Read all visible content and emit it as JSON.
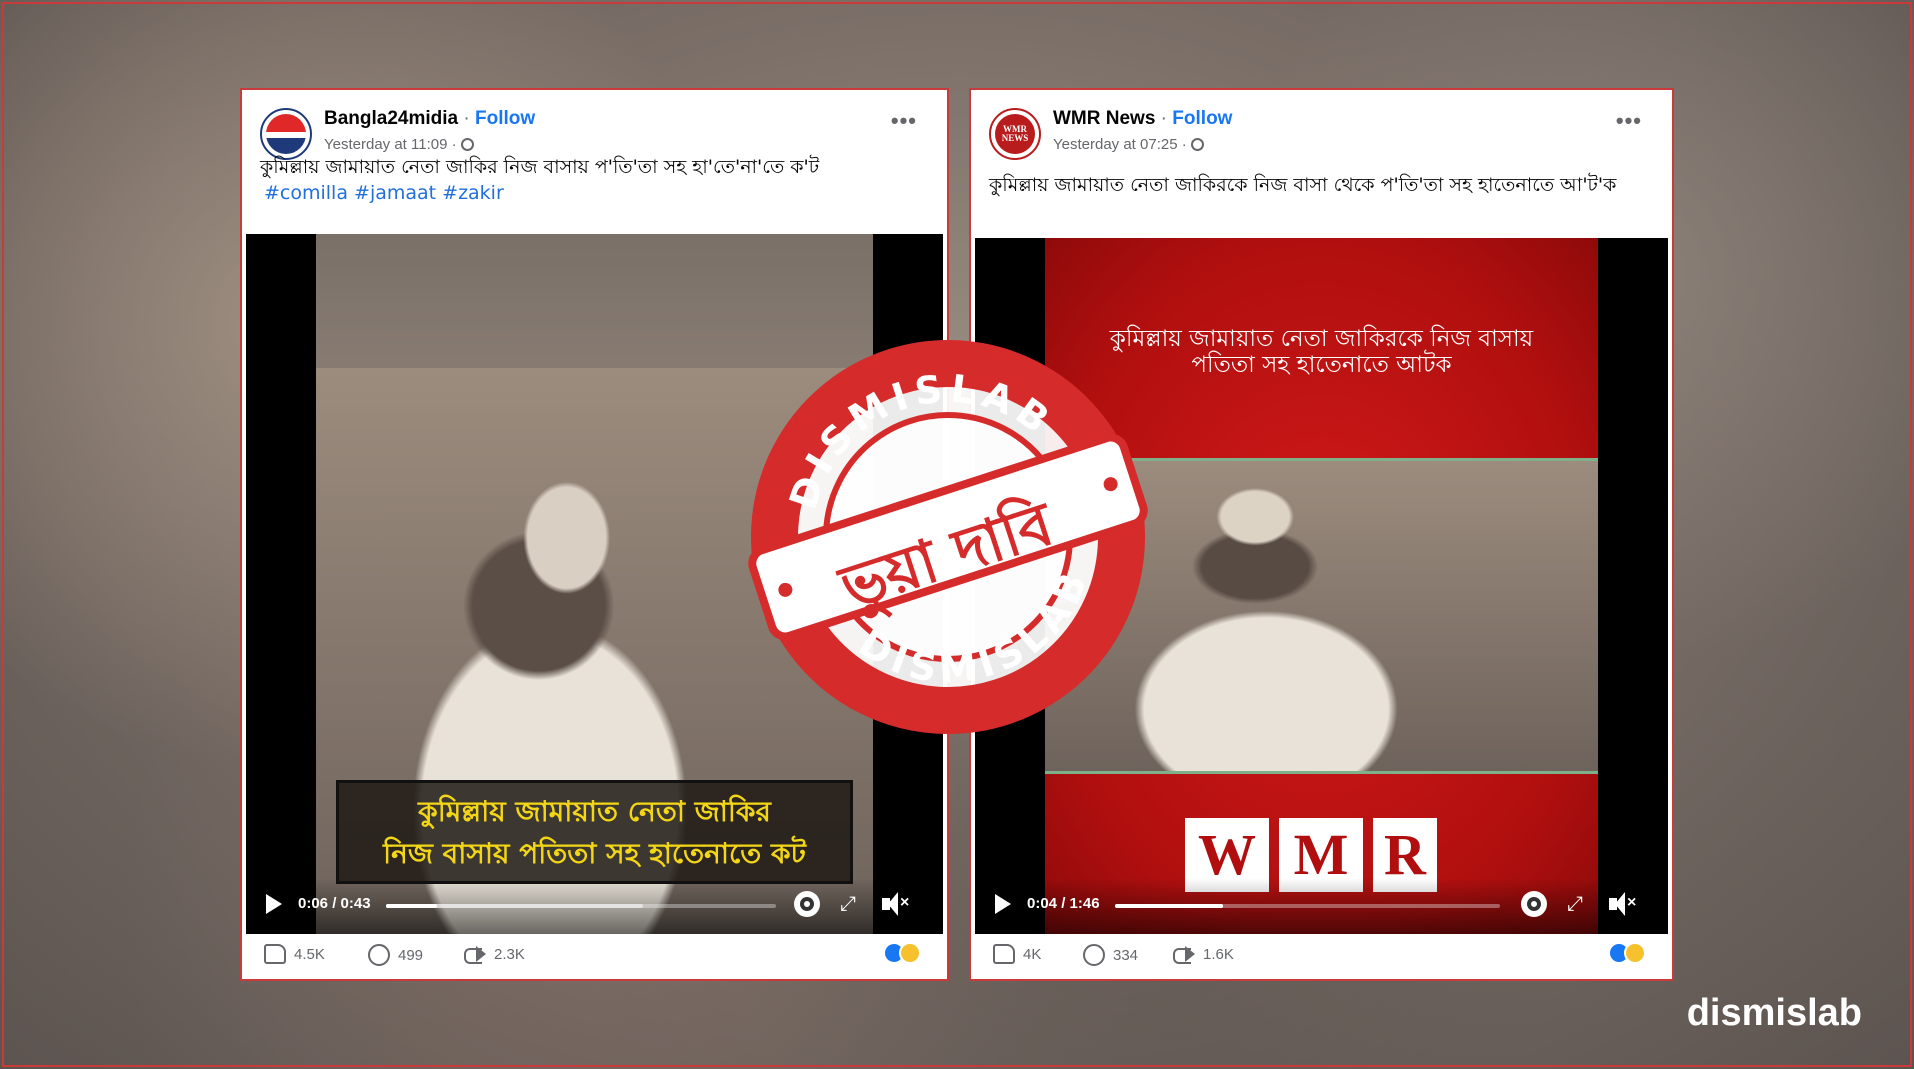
{
  "left_post": {
    "page_name": "Bangla24midia",
    "follow": "Follow",
    "separator": " · ",
    "time": "Yesterday at 11:09 ·",
    "more": "•••",
    "text": "কুমিল্লায় জামায়াত নেতা জাকির নিজ বাসায় প'তি'তা সহ হা'তে'না'তে ক'ট",
    "hashtags": "#comilla #jamaat #zakir",
    "video_caption_line1": "কুমিল্লায় জামায়াত নেতা জাকির",
    "video_caption_line2": "নিজ বাসায় পতিতা সহ হাতেনাতে কট",
    "video_time": "0:06 / 0:43",
    "progress": 0.13,
    "buffer": 0.66,
    "likes": "4.5K",
    "comments": "499",
    "shares": "2.3K"
  },
  "right_post": {
    "page_name": "WMR News",
    "avatar_text": "WMR NEWS",
    "follow": "Follow",
    "separator": " · ",
    "time": "Yesterday at 07:25 ·",
    "more": "•••",
    "text": "কুমিল্লায় জামায়াত নেতা জাকিরকে নিজ বাসা থেকে প'তি'তা সহ হাতেনাতে আ'ট'ক",
    "video_caption_line1": "কুমিল্লায় জামায়াত নেতা জাকিরকে নিজ বাসায়",
    "video_caption_line2": "পতিতা সহ হাতেনাতে আটক",
    "logo_letters": [
      "W",
      "M",
      "R"
    ],
    "video_time": "0:04 / 1:46",
    "progress": 0.28,
    "buffer": 0.28,
    "likes": "4K",
    "comments": "334",
    "shares": "1.6K"
  },
  "stamp": {
    "top_text": "DISMISLAB",
    "bottom_text": "DISMISLAB",
    "center_text": "ভুয়া দাবি",
    "color": "#d62b2b"
  },
  "brand": "dismislab",
  "colors": {
    "follow_blue": "#1877f2",
    "hashtag_blue": "#216fdb",
    "caption_yellow": "#f3d616",
    "wmr_red": "#b10f0f",
    "frame_red": "#c93b3b"
  }
}
